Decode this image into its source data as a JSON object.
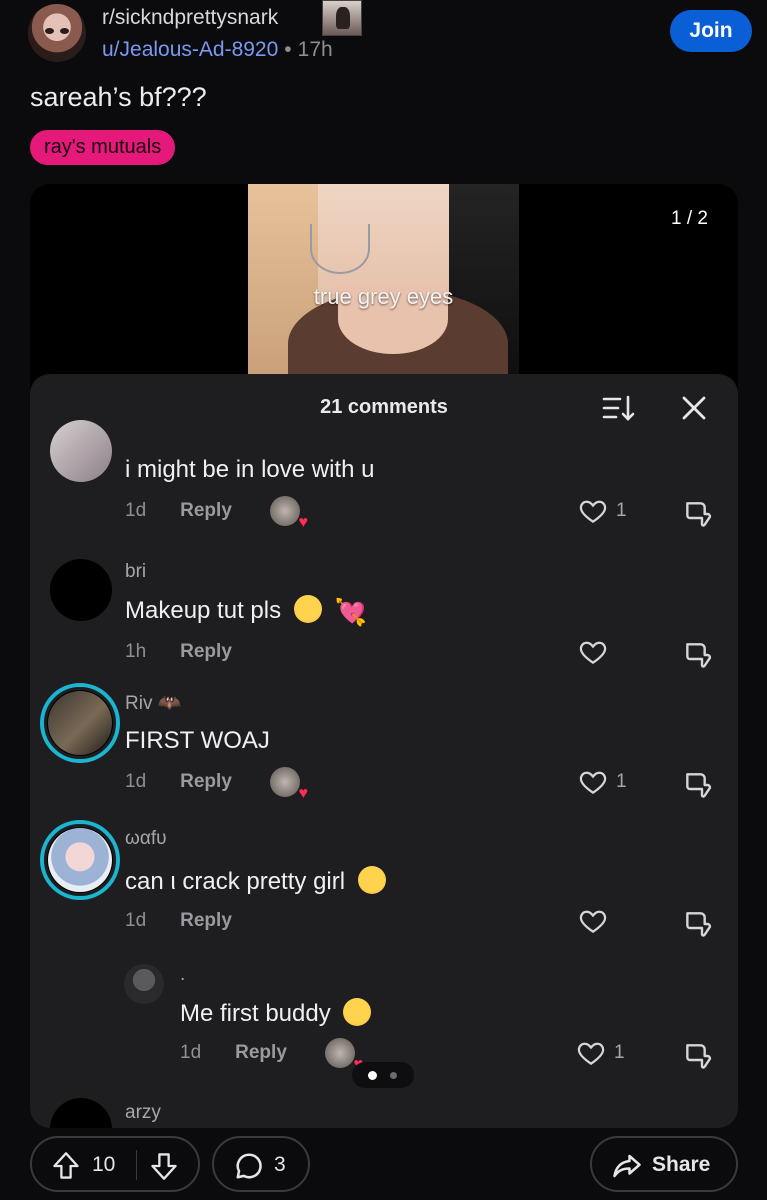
{
  "header": {
    "subreddit": "r/sickndprettysnark",
    "username": "u/Jealous-Ad-8920",
    "separator": "•",
    "age": "17h",
    "join_label": "Join"
  },
  "post": {
    "title": "sareah’s bf???",
    "flair": "ray's mutuals",
    "flair_color": "#e5197a"
  },
  "media": {
    "caption": "true grey eyes",
    "page_counter": "1 / 2",
    "comments_title": "21 comments",
    "comments": [
      {
        "name": "",
        "text": "i might be in love with u",
        "emoji": "",
        "time": "1d",
        "reply": "Reply",
        "creator_liked": true,
        "likes": "1"
      },
      {
        "name": "bri",
        "text": "Makeup tut pls",
        "emoji": "pensive, heart-arrow",
        "time": "1h",
        "reply": "Reply",
        "creator_liked": false,
        "likes": ""
      },
      {
        "name": "Riv",
        "text": "FIRST WOAJ",
        "emoji": "",
        "time": "1d",
        "reply": "Reply",
        "creator_liked": true,
        "likes": "1"
      },
      {
        "name": "ωαfυ",
        "text": "can ι crack pretty girl",
        "emoji": "drooling",
        "time": "1d",
        "reply": "Reply",
        "creator_liked": false,
        "likes": ""
      },
      {
        "name": ".",
        "text": "Me first buddy",
        "emoji": "yawning",
        "time": "1d",
        "reply": "Reply",
        "creator_liked": true,
        "likes": "1"
      },
      {
        "name": "arzy",
        "text": "",
        "emoji": "",
        "time": "",
        "reply": "",
        "creator_liked": false,
        "likes": ""
      }
    ],
    "carousel_pages": 2,
    "carousel_active": 1
  },
  "actions": {
    "score": "10",
    "comments": "3",
    "share_label": "Share"
  },
  "icons": [
    "sort-icon",
    "close-icon",
    "heart-icon",
    "dislike-icon",
    "upvote-icon",
    "downvote-icon",
    "comment-icon",
    "share-icon"
  ]
}
